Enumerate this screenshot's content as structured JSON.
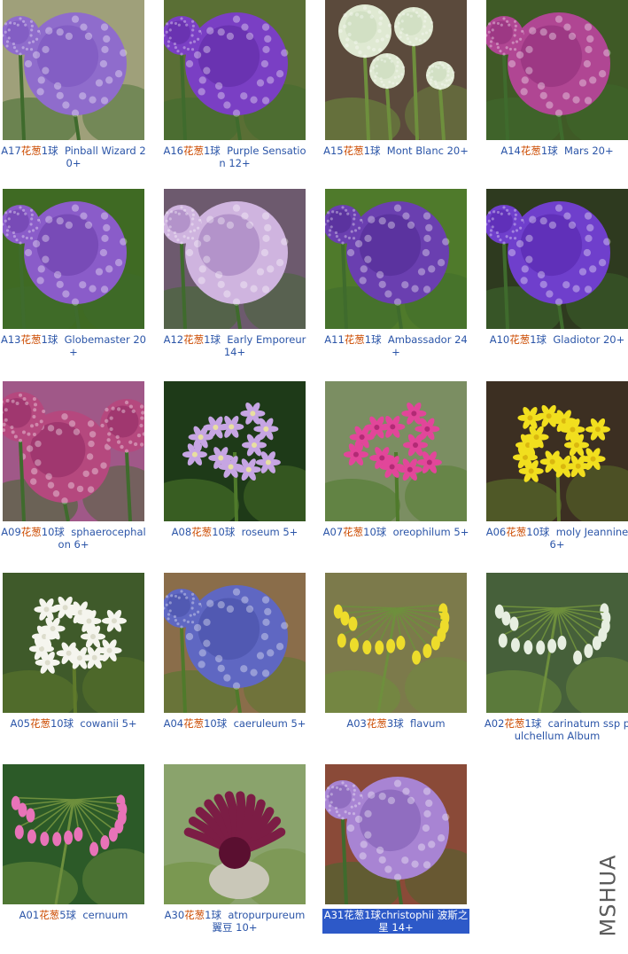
{
  "products": [
    {
      "code": "A17",
      "name": "花葱",
      "count": "1球",
      "variety": "Pinball Wizard 20+",
      "bg": "#9fa07a",
      "flower": "#8f6ccc",
      "center": "#7a54bd",
      "stem": "#3f6b2d",
      "icon": "allium-ball-photo"
    },
    {
      "code": "A16",
      "name": "花葱",
      "count": "1球",
      "variety": "Purple Sensation 12+",
      "bg": "#5a6f35",
      "flower": "#7a3fc4",
      "center": "#5d2aa3",
      "stem": "#3f6b2d",
      "icon": "allium-ball-photo"
    },
    {
      "code": "A15",
      "name": "花葱",
      "count": "1球",
      "variety": "Mont Blanc 20+",
      "bg": "#5b4a3c",
      "flower": "#dfe9d2",
      "center": "#c7d8b8",
      "stem": "#6e8f3d",
      "icon": "allium-white-photo"
    },
    {
      "code": "A14",
      "name": "花葱",
      "count": "1球",
      "variety": "Mars 20+",
      "bg": "#3f5a26",
      "flower": "#b04693",
      "center": "#8e2d78",
      "stem": "#3f6b2d",
      "icon": "allium-ball-photo"
    },
    {
      "code": "A13",
      "name": "花葱",
      "count": "1球",
      "variety": "Globemaster 20+",
      "bg": "#3f6a23",
      "flower": "#8a5cc9",
      "center": "#6a3ea8",
      "stem": "#3f6b2d",
      "icon": "allium-ball-photo"
    },
    {
      "code": "A12",
      "name": "花葱",
      "count": "1球",
      "variety": "Early Emporeur 14+",
      "bg": "#6d5a6e",
      "flower": "#cfb4df",
      "center": "#9d78b8",
      "stem": "#3f6b2d",
      "icon": "allium-ball-photo"
    },
    {
      "code": "A11",
      "name": "花葱",
      "count": "1球",
      "variety": "Ambassador 24+",
      "bg": "#4f7a2b",
      "flower": "#6a3fb0",
      "center": "#4f2a92",
      "stem": "#3f6b2d",
      "icon": "allium-ball-photo"
    },
    {
      "code": "A10",
      "name": "花葱",
      "count": "1球",
      "variety": "Gladiotor 20+",
      "bg": "#2e3a1f",
      "flower": "#6f3fcc",
      "center": "#5425a9",
      "stem": "#3f6b2d",
      "icon": "allium-ball-photo"
    },
    {
      "code": "A09",
      "name": "花葱",
      "count": "10球",
      "variety": "sphaerocephalon 6+",
      "bg": "#a05888",
      "flower": "#b5487e",
      "center": "#8e2a62",
      "stem": "#3f6b2d",
      "icon": "allium-drumstick-photo"
    },
    {
      "code": "A08",
      "name": "花葱",
      "count": "10球",
      "variety": "roseum 5+",
      "bg": "#1e3a18",
      "flower": "#c6a5e3",
      "center": "#e8dfa0",
      "stem": "#4f7a2b",
      "icon": "allium-loose-photo"
    },
    {
      "code": "A07",
      "name": "花葱",
      "count": "10球",
      "variety": "oreophilum 5+",
      "bg": "#7b8e62",
      "flower": "#e2469a",
      "center": "#b22a75",
      "stem": "#4f7a2b",
      "icon": "allium-loose-photo"
    },
    {
      "code": "A06",
      "name": "花葱",
      "count": "10球",
      "variety": "moly Jeannine 6+",
      "bg": "#3c2f22",
      "flower": "#f1df1e",
      "center": "#d9b70f",
      "stem": "#5f7a2b",
      "icon": "allium-star-photo"
    },
    {
      "code": "A05",
      "name": "花葱",
      "count": "10球",
      "variety": "cowanii 5+",
      "bg": "#3f5a2a",
      "flower": "#f5f5ee",
      "center": "#dcdccb",
      "stem": "#5f7a2b",
      "icon": "allium-star-photo"
    },
    {
      "code": "A04",
      "name": "花葱",
      "count": "10球",
      "variety": "caeruleum 5+",
      "bg": "#8a6d4a",
      "flower": "#5f67c2",
      "center": "#464ea6",
      "stem": "#4f7a2b",
      "icon": "allium-ball-photo"
    },
    {
      "code": "A03",
      "name": "花葱",
      "count": "3球",
      "variety": "flavum",
      "bg": "#7c7a4b",
      "flower": "#eddc2b",
      "center": "#c9b514",
      "stem": "#6e8f3d",
      "icon": "allium-drooping-photo"
    },
    {
      "code": "A02",
      "name": "花葱",
      "count": "1球",
      "variety": "carinatum ssp pulchellum Album",
      "bg": "#46603a",
      "flower": "#e6eee0",
      "center": "#b9c8b0",
      "stem": "#6e8f3d",
      "icon": "allium-drooping-photo"
    },
    {
      "code": "A01",
      "name": "花葱",
      "count": "5球",
      "variety": "cernuum",
      "bg": "#2c5a28",
      "flower": "#e873b8",
      "center": "#c64d97",
      "stem": "#6e8f3d",
      "icon": "allium-drooping-photo"
    },
    {
      "code": "A30",
      "name": "花葱",
      "count": "1球",
      "variety": "atropurpureum 翼豆 10+",
      "bg": "#8aa36c",
      "flower": "#7c1d45",
      "center": "#5a0f30",
      "stem": "#6e8f3d",
      "icon": "allium-bud-photo"
    },
    {
      "code": "A31",
      "name": "花葱",
      "count": "1球",
      "variety": "christophii 波斯之星 14+",
      "bg": "#8a4a38",
      "flower": "#a884d3",
      "center": "#7c5bb0",
      "stem": "#3f6b2d",
      "icon": "allium-ball-photo",
      "selected": true
    }
  ],
  "watermark": "MSHUA",
  "colors": {
    "link": "#2b55a8",
    "highlight": "#cc4b00",
    "selection": "#2d59c8"
  }
}
